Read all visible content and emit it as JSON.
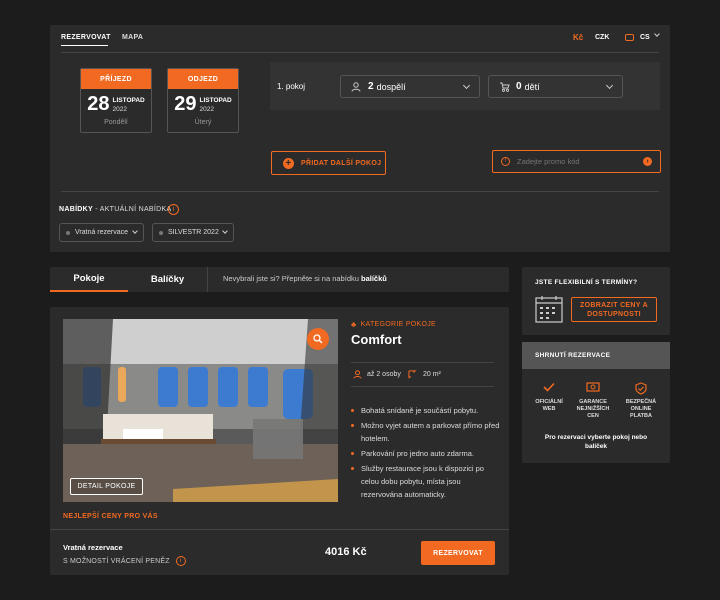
{
  "nav": {
    "book": "REZERVOVAT",
    "map": "MAPA",
    "currency_symbol": "Kč",
    "currency": "CZK",
    "language": "CS"
  },
  "dates": {
    "arrival": {
      "label": "PŘÍJEZD",
      "day": "28",
      "month": "LISTOPAD",
      "year": "2022",
      "weekday": "Pondělí"
    },
    "departure": {
      "label": "ODJEZD",
      "day": "29",
      "month": "LISTOPAD",
      "year": "2022",
      "weekday": "Úterý"
    }
  },
  "room": {
    "label": "1. pokoj",
    "adults_count": "2",
    "adults_label": "dospělí",
    "children_count": "0",
    "children_label": "dětí"
  },
  "add_room_label": "PŘIDAT DALŠÍ POKOJ",
  "promo": {
    "placeholder": "Zadejte promo kód"
  },
  "offers": {
    "title_bold": "NABÍDKY",
    "title_rest": " - AKTUÁLNÍ NABÍDKA",
    "chips": [
      "Vratná rezervace",
      "SILVESTR 2022"
    ]
  },
  "tabs": {
    "rooms": "Pokoje",
    "packages": "Balíčky",
    "hint_text": "Nevybrali jste si? Přepněte si na nabídku ",
    "hint_bold": "balíčků"
  },
  "room_card": {
    "category": "KATEGORIE POKOJE",
    "name": "Comfort",
    "persons": "až 2 osoby",
    "area": "20 m²",
    "detail_button": "DETAIL POKOJE",
    "features": [
      "Bohatá snídaně je součástí pobytu.",
      "Možno vyjet autem a parkovat přímo před hotelem.",
      "Parkování pro jedno auto zdarma.",
      "Služby restaurace jsou k dispozici po celou dobu pobytu, místa jsou rezervována automaticky."
    ],
    "best_price": "NEJLEPŠÍ CENY PRO VÁS",
    "rate_name": "Vratná rezervace",
    "rate_note": "S MOŽNOSTÍ VRÁCENÍ PENĚZ",
    "price": "4016 Kč",
    "book_button": "REZERVOVAT"
  },
  "flex": {
    "title": "JSTE FLEXIBILNÍ S TERMÍNY?",
    "button": "ZOBRAZIT CENY A DOSTUPNOSTI"
  },
  "summary": {
    "title": "SHRNUTÍ REZERVACE",
    "badges": [
      {
        "icon": "check-icon",
        "label": "OFICIÁLNÍ WEB"
      },
      {
        "icon": "money-icon",
        "label": "GARANCE NEJNIŽŠÍCH CEN"
      },
      {
        "icon": "shield-check-icon",
        "label": "BEZPEČNÁ ONLINE PLATBA"
      }
    ],
    "note": "Pro rezervaci vyberte pokoj nebo balíček"
  },
  "colors": {
    "accent": "#f26a21",
    "card": "#2b2b2b",
    "background": "#1c1c1c"
  }
}
